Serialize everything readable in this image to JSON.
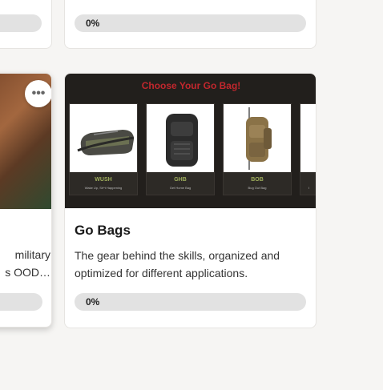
{
  "top_row": {
    "left_card": {
      "progress": ""
    },
    "right_card": {
      "progress": "0%"
    }
  },
  "left_card": {
    "desc_line1": "military",
    "desc_line2": "s OOD…",
    "more_label": "•••"
  },
  "main_card": {
    "banner_title": "Choose Your Go Bag!",
    "tiles": [
      {
        "name": "WUSH",
        "sub": "Wake Up, Sh*t Happening"
      },
      {
        "name": "GHB",
        "sub": "Get Home Bag"
      },
      {
        "name": "BOB",
        "sub": "Bug Out Bag"
      },
      {
        "name": "",
        "sub": "I"
      }
    ],
    "title": "Go Bags",
    "description": "The gear behind the skills, organized and optimized for different applications.",
    "progress": "0%"
  }
}
